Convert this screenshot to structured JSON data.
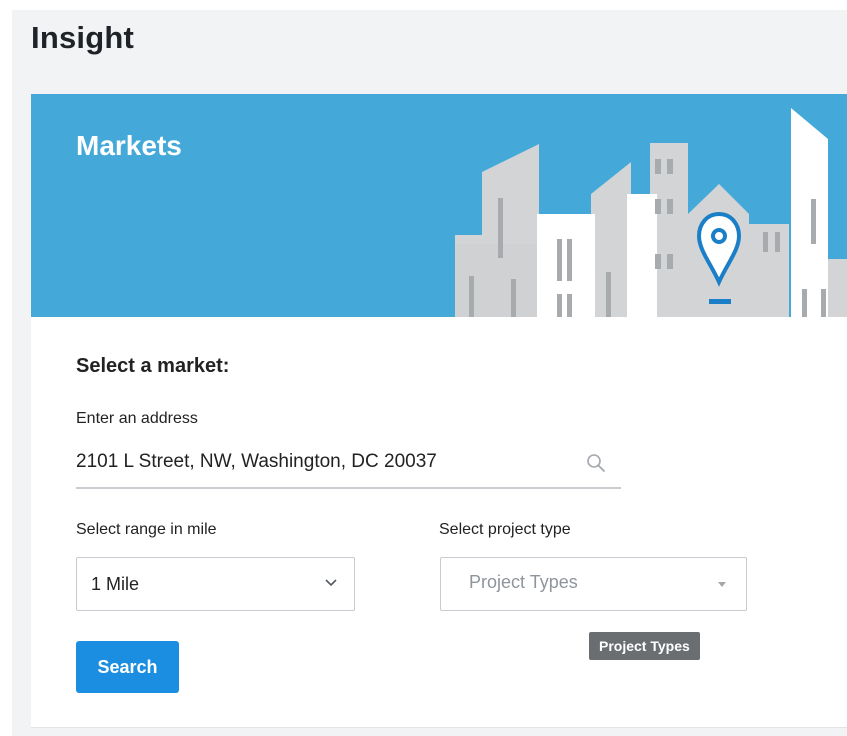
{
  "app": {
    "title": "Insight"
  },
  "banner": {
    "title": "Markets"
  },
  "form": {
    "heading": "Select a market:",
    "address": {
      "label": "Enter an address",
      "value": "2101 L Street, NW, Washington, DC 20037",
      "icon": "search-icon"
    },
    "range": {
      "label": "Select range in mile",
      "selected": "1 Mile",
      "icon": "chevron-down-icon"
    },
    "project_type": {
      "label": "Select project type",
      "placeholder": "Project Types",
      "icon": "caret-down-icon",
      "tooltip": "Project Types"
    },
    "search_button": "Search"
  },
  "colors": {
    "banner": "#44a9d8",
    "accent": "#1b8ee2",
    "map_pin": "#1b7fc7"
  }
}
